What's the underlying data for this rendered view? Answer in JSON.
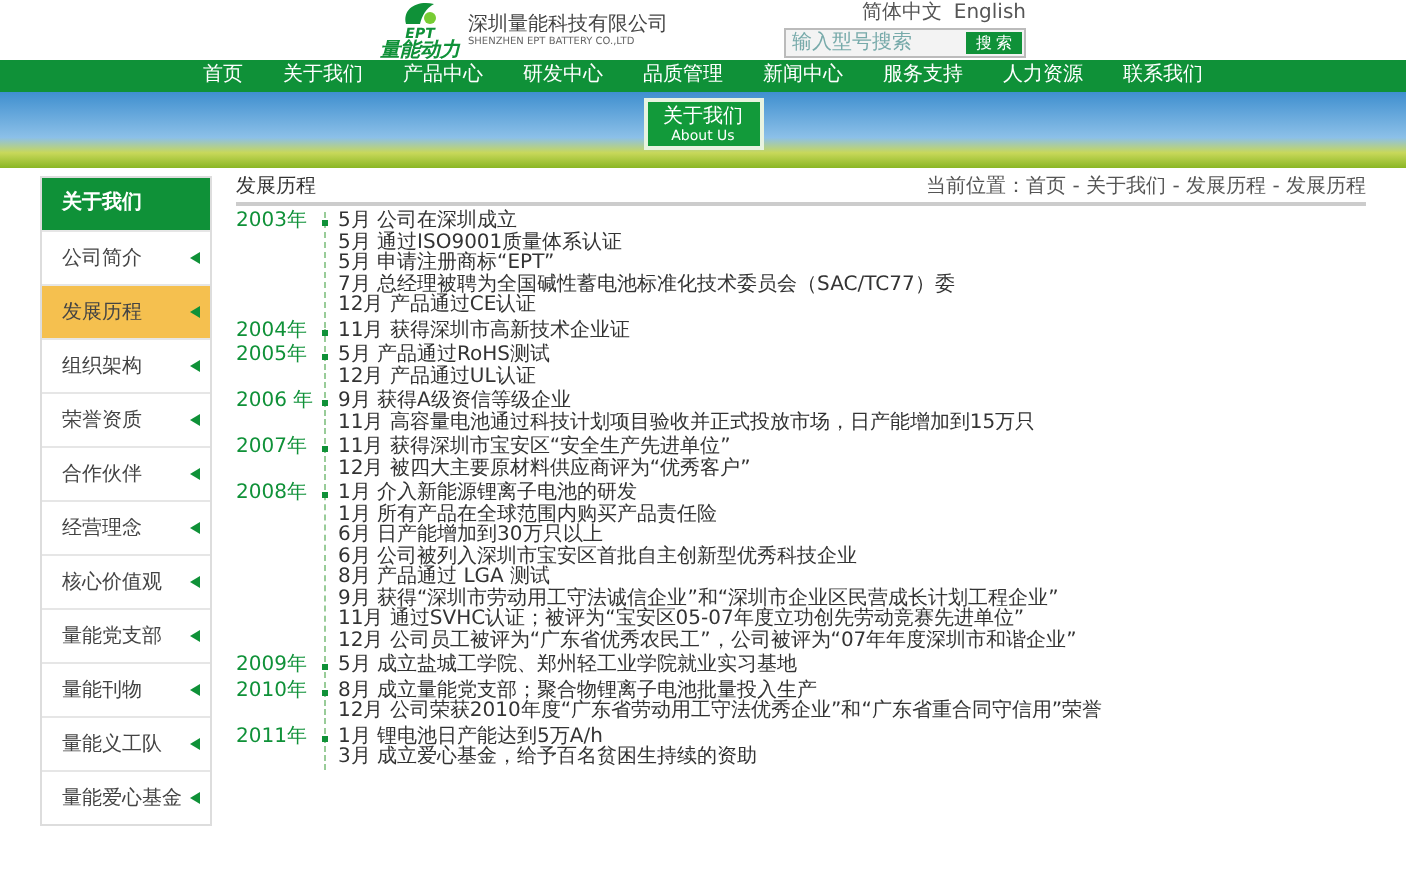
{
  "header": {
    "logo": {
      "mark": "EPT",
      "name": "量能动力"
    },
    "company": "深圳量能科技有限公司",
    "company_en": "SHENZHEN EPT BATTERY CO.,LTD",
    "languages": [
      "简体中文",
      "English"
    ],
    "search": {
      "placeholder": "输入型号搜索",
      "button": "搜 索"
    }
  },
  "nav": [
    "首页",
    "关于我们",
    "产品中心",
    "研发中心",
    "品质管理",
    "新闻中心",
    "服务支持",
    "人力资源",
    "联系我们"
  ],
  "banner": {
    "title": "关于我们",
    "subtitle": "About Us"
  },
  "sidebar": {
    "title": "关于我们",
    "items": [
      {
        "label": "公司简介",
        "selected": false
      },
      {
        "label": "发展历程",
        "selected": true
      },
      {
        "label": "组织架构",
        "selected": false
      },
      {
        "label": "荣誉资质",
        "selected": false
      },
      {
        "label": "合作伙伴",
        "selected": false
      },
      {
        "label": "经营理念",
        "selected": false
      },
      {
        "label": "核心价值观",
        "selected": false
      },
      {
        "label": "量能党支部",
        "selected": false
      },
      {
        "label": "量能刊物",
        "selected": false
      },
      {
        "label": "量能义工队",
        "selected": false
      },
      {
        "label": "量能爱心基金",
        "selected": false
      }
    ]
  },
  "content": {
    "title": "发展历程",
    "breadcrumb": "当前位置：首页 - 关于我们 - 发展历程 - 发展历程",
    "timeline": [
      {
        "year": "2003年",
        "events": [
          "5月 公司在深圳成立",
          "5月 通过ISO9001质量体系认证",
          "5月 申请注册商标“EPT”",
          "7月 总经理被聘为全国碱性蓄电池标准化技术委员会（SAC/TC77）委",
          "12月 产品通过CE认证"
        ]
      },
      {
        "year": "2004年",
        "events": [
          "11月 获得深圳市高新技术企业证"
        ]
      },
      {
        "year": "2005年",
        "events": [
          "5月 产品通过RoHS测试",
          "12月 产品通过UL认证"
        ]
      },
      {
        "year": "2006 年",
        "events": [
          "9月 获得A级资信等级企业",
          "11月 高容量电池通过科技计划项目验收并正式投放市场，日产能增加到15万只"
        ]
      },
      {
        "year": "2007年",
        "events": [
          "11月 获得深圳市宝安区“安全生产先进单位”",
          "12月 被四大主要原材料供应商评为“优秀客户”"
        ]
      },
      {
        "year": "2008年",
        "events": [
          "1月 介入新能源锂离子电池的研发",
          "1月 所有产品在全球范围内购买产品责任险",
          "6月 日产能增加到30万只以上",
          "6月 公司被列入深圳市宝安区首批自主创新型优秀科技企业",
          "8月 产品通过 LGA 测试",
          "9月 获得“深圳市劳动用工守法诚信企业”和“深圳市企业区民营成长计划工程企业”",
          "11月 通过SVHC认证；被评为“宝安区05-07年度立功创先劳动竞赛先进单位”",
          "12月 公司员工被评为“广东省优秀农民工”，公司被评为“07年年度深圳市和谐企业”"
        ]
      },
      {
        "year": "2009年",
        "events": [
          "5月 成立盐城工学院、郑州轻工业学院就业实习基地"
        ]
      },
      {
        "year": "2010年",
        "events": [
          "8月 成立量能党支部；聚合物锂离子电池批量投入生产",
          "12月 公司荣获2010年度“广东省劳动用工守法优秀企业”和“广东省重合同守信用”荣誉"
        ]
      },
      {
        "year": "2011年",
        "events": [
          "1月 锂电池日产能达到5万A/h",
          "3月 成立爱心基金，给予百名贫困生持续的资助"
        ]
      }
    ]
  }
}
